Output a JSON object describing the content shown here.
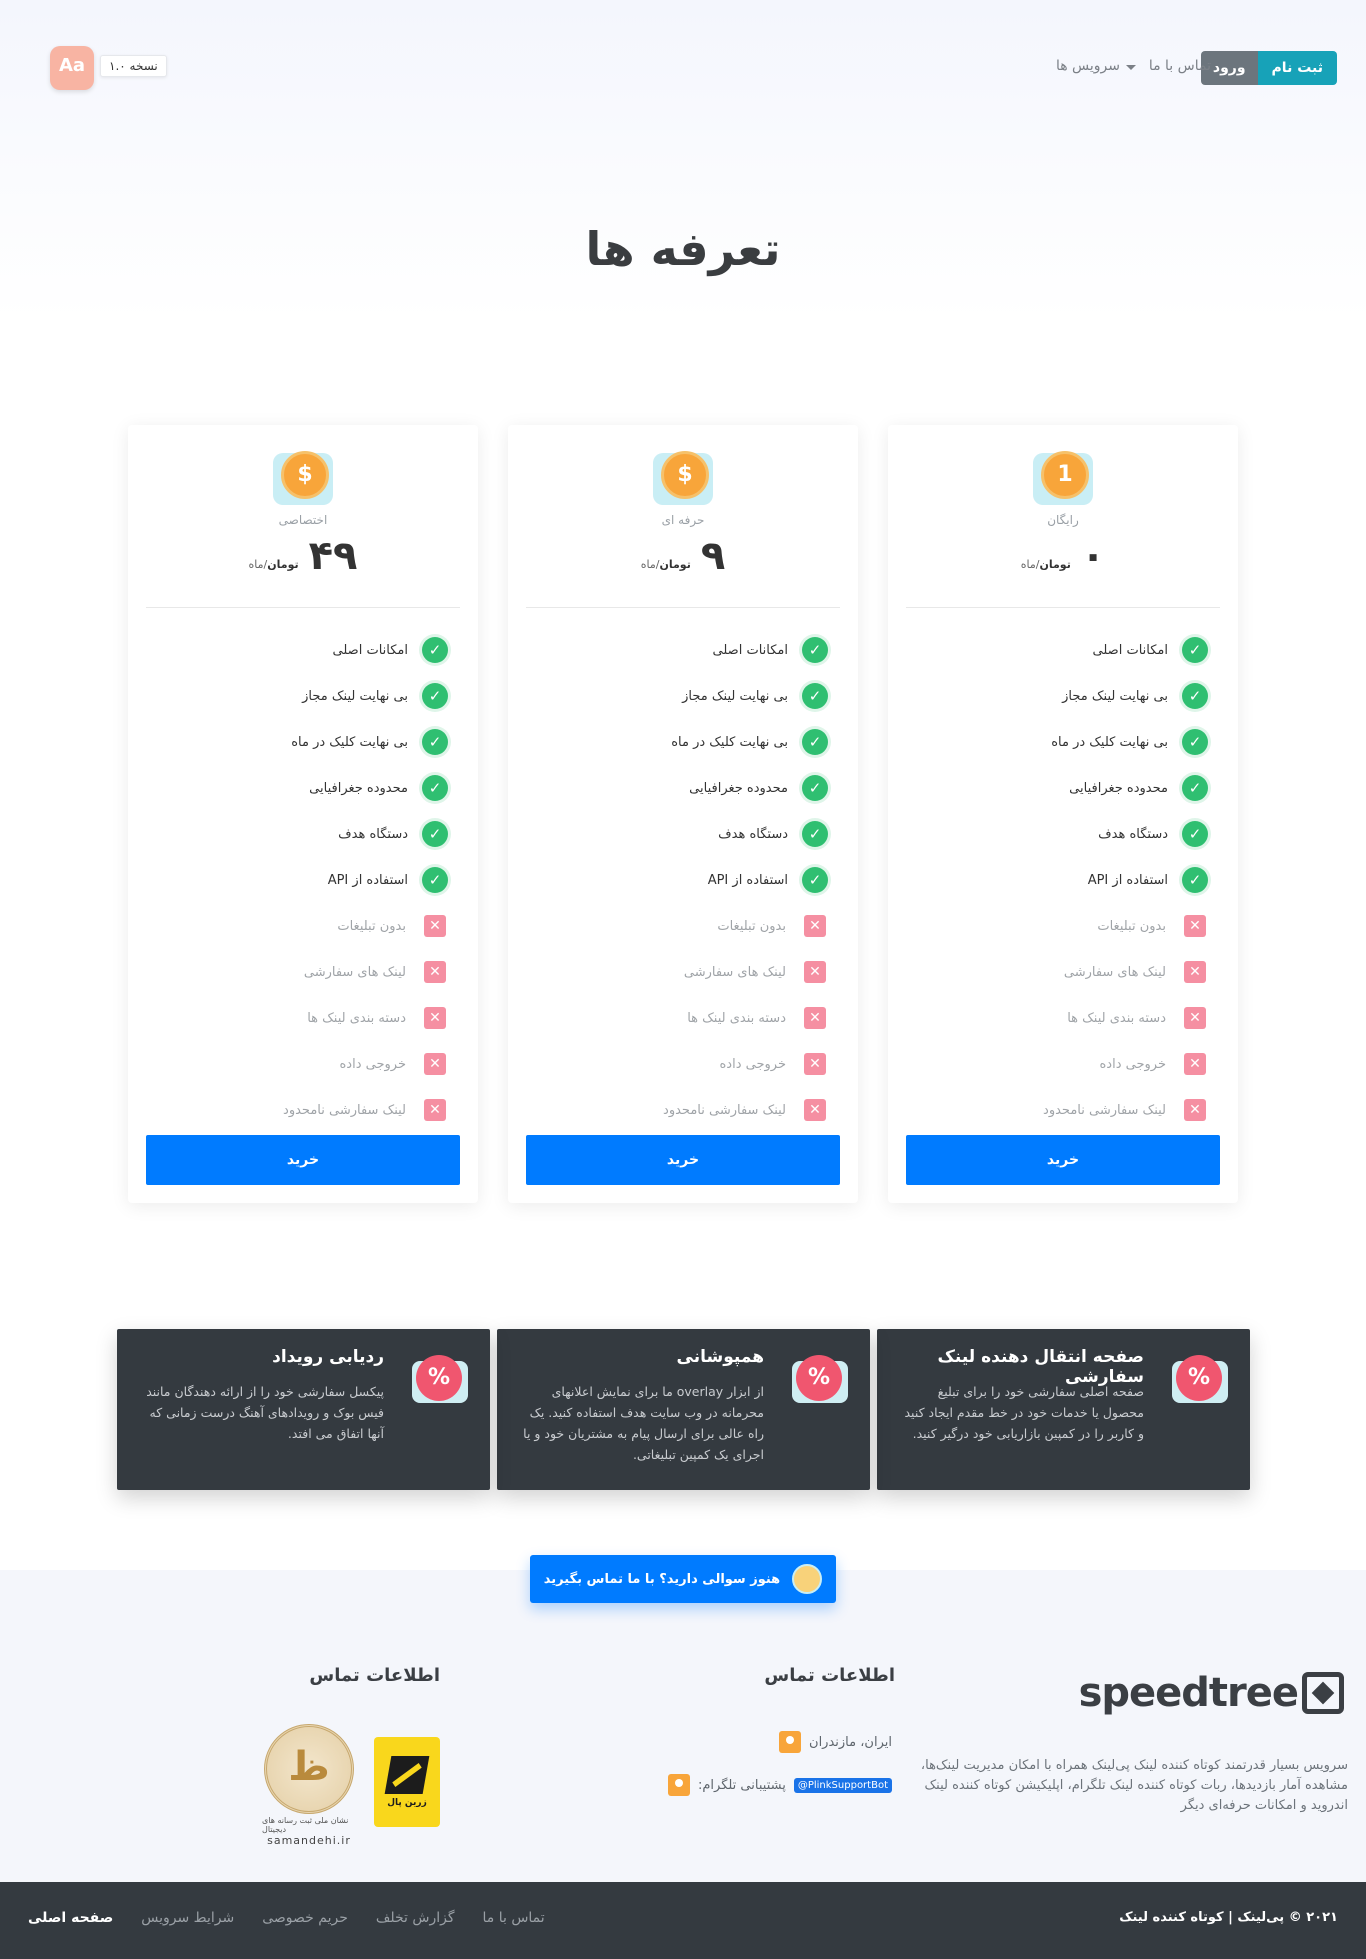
{
  "nav": {
    "register_label": "ثبت نام",
    "login_label": "ورود",
    "contact_label": "تماس با ما",
    "services_label": "سرویس ها",
    "version_label": "نسخه ۱.۰",
    "font_toggle_label": "Aa"
  },
  "page_title": "تعرفه ها",
  "plans": [
    {
      "name": "رایگان",
      "coin_symbol": "1",
      "price": "۰",
      "currency": "تومان",
      "period": "/ماه",
      "buy_label": "خرید",
      "features_ok": [
        "امکانات اصلی",
        "بی نهایت لینک مجاز",
        "بی نهایت کلیک در ماه",
        "محدوده جغرافیایی",
        "دستگاه هدف",
        "استفاده از API"
      ],
      "features_no": [
        "بدون تبلیغات",
        "لینک های سفارشی",
        "دسته بندی لینک ها",
        "خروجی داده",
        "لینک سفارشی نامحدود"
      ]
    },
    {
      "name": "حرفه ای",
      "coin_symbol": "$",
      "price": "۹",
      "currency": "تومان",
      "period": "/ماه",
      "buy_label": "خرید",
      "features_ok": [
        "امکانات اصلی",
        "بی نهایت لینک مجاز",
        "بی نهایت کلیک در ماه",
        "محدوده جغرافیایی",
        "دستگاه هدف",
        "استفاده از API"
      ],
      "features_no": [
        "بدون تبلیغات",
        "لینک های سفارشی",
        "دسته بندی لینک ها",
        "خروجی داده",
        "لینک سفارشی نامحدود"
      ]
    },
    {
      "name": "اختصاصی",
      "coin_symbol": "$",
      "price": "۴۹",
      "currency": "تومان",
      "period": "/ماه",
      "buy_label": "خرید",
      "features_ok": [
        "امکانات اصلی",
        "بی نهایت لینک مجاز",
        "بی نهایت کلیک در ماه",
        "محدوده جغرافیایی",
        "دستگاه هدف",
        "استفاده از API"
      ],
      "features_no": [
        "بدون تبلیغات",
        "لینک های سفارشی",
        "دسته بندی لینک ها",
        "خروجی داده",
        "لینک سفارشی نامحدود"
      ]
    }
  ],
  "feature_boxes": [
    {
      "title": "صفحه انتقال دهنده لینک سفارشی",
      "description": "صفحه اصلی سفارشی خود را برای تبلیغ محصول یا خدمات خود در خط مقدم ایجاد کنید و کاربر را در کمپین بازاریابی خود درگیر کنید."
    },
    {
      "title": "همپوشانی",
      "description": "از ابزار overlay ما برای نمایش اعلانهای محرمانه در وب سایت هدف استفاده کنید. یک راه عالی برای ارسال پیام به مشتریان خود و یا اجرای یک کمپین تبلیغاتی."
    },
    {
      "title": "ردیابی رویداد",
      "description": "پیکسل سفارشی خود را از ارائه دهندگان مانند فیس بوک و رویدادهای آهنگ درست زمانی که آنها اتفاق می افتد."
    }
  ],
  "help_cta": "هنوز سوالی دارید؟ با ما تماس بگیرید",
  "footer": {
    "logo_text": "speedtree",
    "about": "سرویس بسیار قدرتمند کوتاه کننده لینک پی‌لینک همراه با امکان مدیریت لینک‌ها، مشاهده آمار بازدیدها، ربات کوتاه کننده لینک تلگرام، اپلیکیشن کوتاه کننده لینک اندروید و امکانات حرفه‌ای دیگر",
    "contact_title_1": "اطلاعات تماس",
    "contact_title_2": "اطلاعات تماس",
    "location": "ایران، مازندران",
    "telegram_label": "پشتیبانی تلگرام:",
    "telegram_handle": "@PlinkSupportBot",
    "zarinpal_text": "زرین پال",
    "samandehi_caption": "نشان ملی ثبت رسانه های دیجیتال",
    "samandehi_url": "samandehi.ir"
  },
  "bottom_bar": {
    "copyright": "۲۰۲۱ © پی‌لینک | کوتاه کننده لینک",
    "links": [
      "صفحه اصلی",
      "شرایط سرویس",
      "حریم خصوصی",
      "گزارش تخلف",
      "تماس با ما"
    ]
  }
}
